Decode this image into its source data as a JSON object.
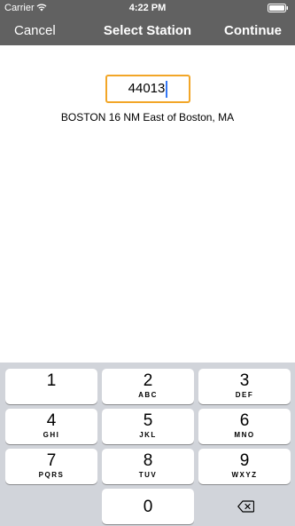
{
  "status_bar": {
    "carrier": "Carrier",
    "time": "4:22 PM"
  },
  "nav": {
    "cancel_label": "Cancel",
    "title": "Select Station",
    "continue_label": "Continue"
  },
  "station": {
    "input_value": "44013",
    "description": "BOSTON 16 NM East of Boston, MA"
  },
  "keypad": {
    "keys": [
      {
        "num": "1",
        "letters": ""
      },
      {
        "num": "2",
        "letters": "ABC"
      },
      {
        "num": "3",
        "letters": "DEF"
      },
      {
        "num": "4",
        "letters": "GHI"
      },
      {
        "num": "5",
        "letters": "JKL"
      },
      {
        "num": "6",
        "letters": "MNO"
      },
      {
        "num": "7",
        "letters": "PQRS"
      },
      {
        "num": "8",
        "letters": "TUV"
      },
      {
        "num": "9",
        "letters": "WXYZ"
      },
      {
        "num": "0",
        "letters": ""
      }
    ]
  },
  "colors": {
    "nav_background": "#616161",
    "input_border": "#f2a628",
    "keypad_background": "#d1d4da",
    "caret": "#3478f6"
  },
  "icons": {
    "wifi": "wifi-icon",
    "battery": "battery-icon",
    "delete": "backspace-icon"
  }
}
